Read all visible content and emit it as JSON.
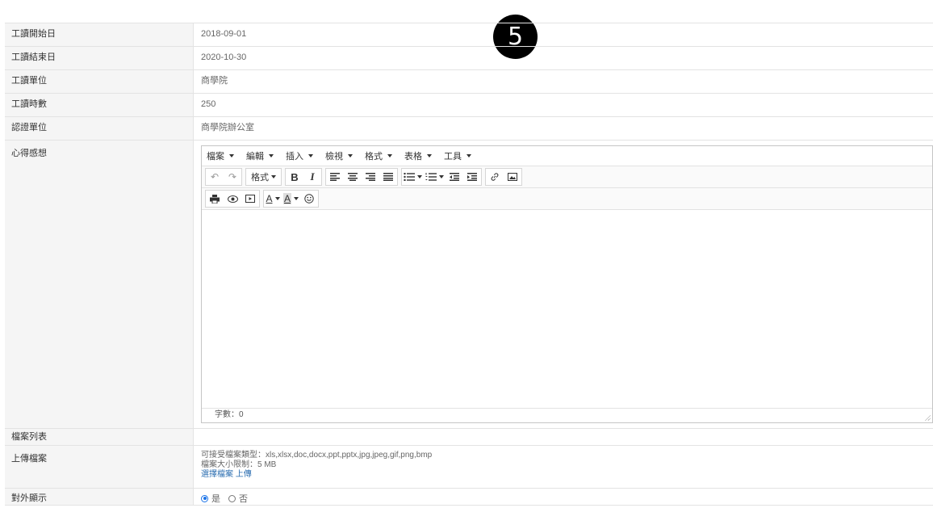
{
  "fields": {
    "start_date": {
      "label": "工讀開始日",
      "value": "2018-09-01"
    },
    "end_date": {
      "label": "工讀結束日",
      "value": "2020-10-30"
    },
    "unit": {
      "label": "工讀單位",
      "value": "商學院"
    },
    "hours": {
      "label": "工讀時數",
      "value": "250"
    },
    "cert_unit": {
      "label": "認證單位",
      "value": "商學院辦公室"
    },
    "reflection": {
      "label": "心得感想"
    },
    "file_list": {
      "label": "檔案列表"
    },
    "upload": {
      "label": "上傳檔案",
      "accepted_types": "可接受檔案類型：xls,xlsx,doc,docx,ppt,pptx,jpg,jpeg,gif,png,bmp",
      "size_limit": "檔案大小限制：5 MB",
      "choose_file": "選擇檔案",
      "upload_link": "上傳"
    },
    "public_display": {
      "label": "對外顯示",
      "option_yes": "是",
      "option_no": "否",
      "selected": "是"
    }
  },
  "editor": {
    "menus": [
      "檔案",
      "編輯",
      "插入",
      "檢視",
      "格式",
      "表格",
      "工具"
    ],
    "format_label": "格式",
    "bold_glyph": "B",
    "italic_glyph": "I",
    "font_color_glyph": "A",
    "bg_color_glyph": "A",
    "word_count": "字數：0"
  },
  "badge": {
    "number": "5"
  }
}
